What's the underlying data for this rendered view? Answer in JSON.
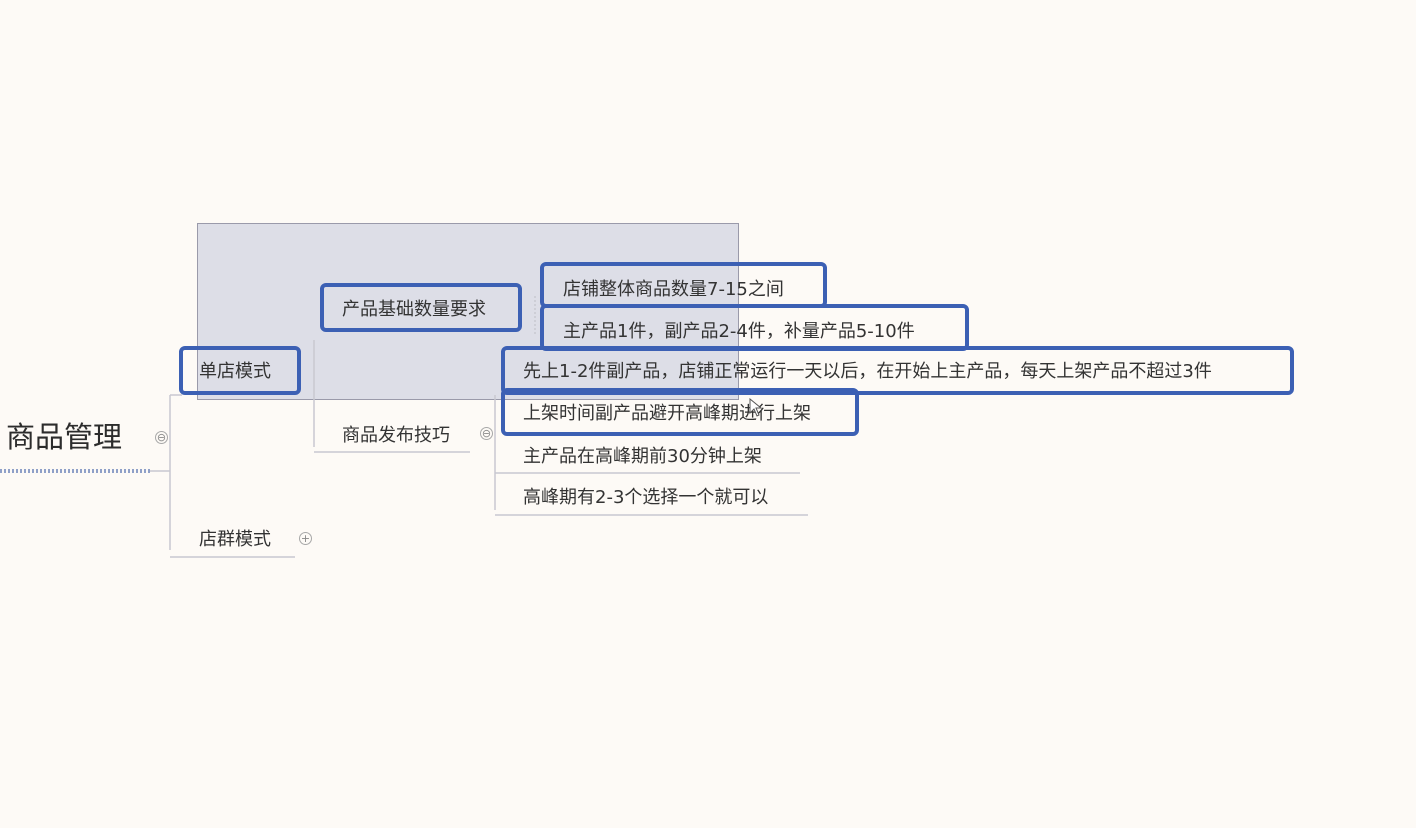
{
  "root": {
    "label": "商品管理",
    "toggle": "⊖"
  },
  "branches": [
    {
      "label": "单店模式",
      "children": [
        {
          "label": "产品基础数量要求",
          "children": [
            "店铺整体商品数量7-15之间",
            "主产品1件，副产品2-4件，补量产品5-10件"
          ]
        },
        {
          "label": "商品发布技巧",
          "toggle": "⊖",
          "children": [
            "先上1-2件副产品，店铺正常运行一天以后，在开始上主产品，每天上架产品不超过3件",
            "上架时间副产品避开高峰期进行上架",
            "主产品在高峰期前30分钟上架",
            "高峰期有2-3个选择一个就可以"
          ]
        }
      ]
    },
    {
      "label": "店群模式",
      "toggle": "+"
    }
  ],
  "colors": {
    "highlight": "#3c60b4",
    "connector": "#c8c8d0",
    "background": "#fdfaf6"
  }
}
